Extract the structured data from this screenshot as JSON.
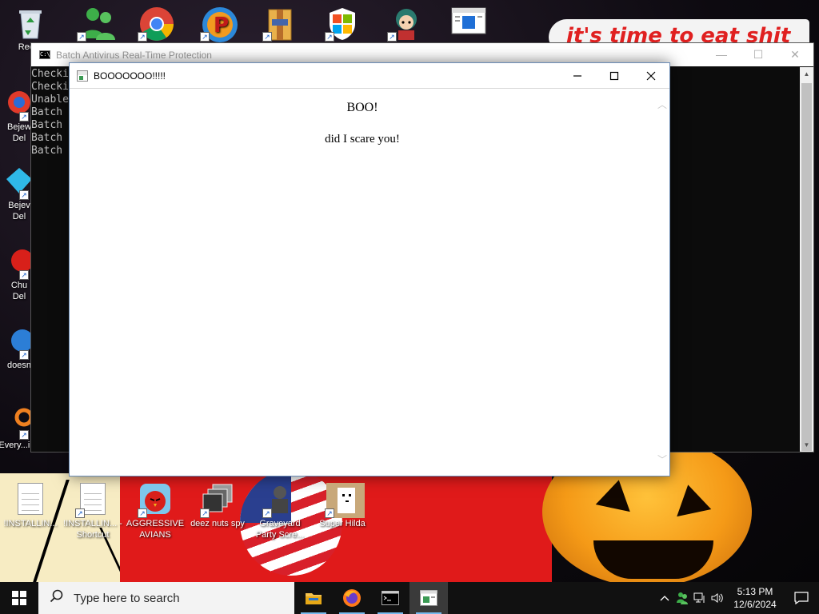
{
  "desktop": {
    "banner_text": "it's time to eat shit",
    "top_icons": [
      {
        "label": "Recyc",
        "icon": "recycle-bin-icon"
      },
      {
        "label": "",
        "icon": "messenger-icon"
      },
      {
        "label": "",
        "icon": "chrome-icon"
      },
      {
        "label": "",
        "icon": "p-app-icon"
      },
      {
        "label": "",
        "icon": "folder-archive-icon"
      },
      {
        "label": "",
        "icon": "windows-shield-icon"
      },
      {
        "label": "",
        "icon": "anime-character-icon"
      },
      {
        "label": "",
        "icon": "window-app-icon"
      }
    ],
    "left_icons": [
      {
        "label": "Bejew\nDel",
        "icon": "bejeweled-icon"
      },
      {
        "label": "Bejev\nDel",
        "icon": "diamond-icon"
      },
      {
        "label": "Chu\nDel",
        "icon": "red-character-icon"
      },
      {
        "label": "doesn",
        "icon": "blue-bird-icon"
      },
      {
        "label": "Every...ing",
        "icon": "everything-search-icon"
      }
    ],
    "bottom_icons": [
      {
        "label": "!INSTALLIN...",
        "icon": "text-document-icon"
      },
      {
        "label": "!INSTALLIN... - Shortcut",
        "icon": "text-document-shortcut-icon"
      },
      {
        "label": "AGGRESSIVE AVIANS",
        "icon": "angry-bird-icon"
      },
      {
        "label": "deez nuts spy",
        "icon": "windows-stack-icon"
      },
      {
        "label": "Graveyard Party Scre...",
        "icon": "graveyard-character-icon"
      },
      {
        "label": "Super Hilda",
        "icon": "pixel-cat-icon"
      }
    ]
  },
  "console_window": {
    "title": "Batch Antivirus Real-Time Protection",
    "lines": [
      "Checki",
      "Checki",
      "Unable",
      "Batch",
      "Batch",
      "Batch",
      "Batch"
    ]
  },
  "popup": {
    "title": "BOOOOOOO!!!!!",
    "heading": "BOO!",
    "text": "did I scare you!"
  },
  "taskbar": {
    "search_placeholder": "Type here to search",
    "apps": [
      {
        "name": "file-explorer-icon"
      },
      {
        "name": "firefox-icon"
      },
      {
        "name": "command-prompt-icon"
      },
      {
        "name": "popup-app-icon"
      }
    ],
    "time": "5:13 PM",
    "date": "12/6/2024"
  },
  "colors": {
    "taskbar_bg": "#111111",
    "console_bg": "#0c0c0c",
    "accent": "#76b9ed"
  }
}
